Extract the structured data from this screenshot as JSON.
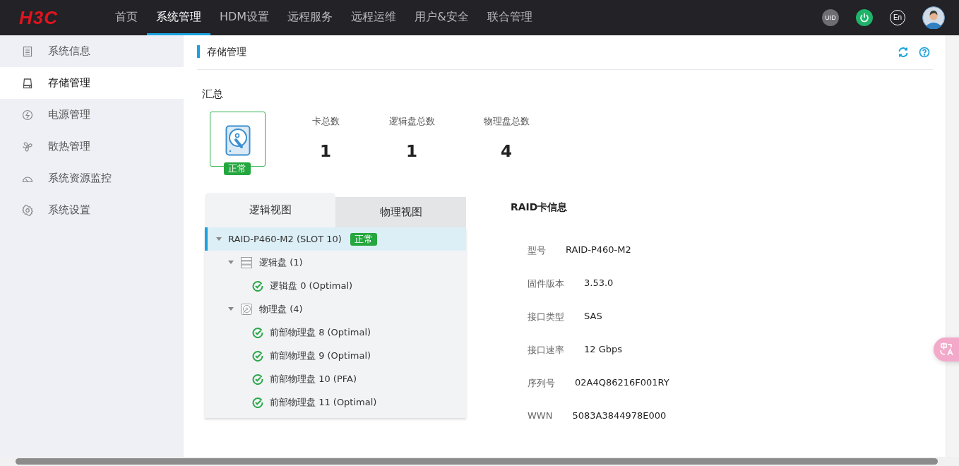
{
  "topbar": {
    "logo": "H3C",
    "nav": [
      {
        "label": "首页",
        "selected": false
      },
      {
        "label": "系统管理",
        "selected": true
      },
      {
        "label": "HDM设置",
        "selected": false
      },
      {
        "label": "远程服务",
        "selected": false
      },
      {
        "label": "远程运维",
        "selected": false
      },
      {
        "label": "用户&安全",
        "selected": false
      },
      {
        "label": "联合管理",
        "selected": false
      }
    ],
    "uid_label": "UID",
    "language_label": "En"
  },
  "sidebar": {
    "items": [
      {
        "label": "系统信息",
        "kind": "list",
        "selected": false
      },
      {
        "label": "存储管理",
        "kind": "drive",
        "selected": true
      },
      {
        "label": "电源管理",
        "kind": "power",
        "selected": false
      },
      {
        "label": "散热管理",
        "kind": "fan",
        "selected": false
      },
      {
        "label": "系统资源监控",
        "kind": "gauge",
        "selected": false
      },
      {
        "label": "系统设置",
        "kind": "gear",
        "selected": false
      }
    ]
  },
  "page": {
    "title": "存储管理"
  },
  "summary": {
    "title": "汇总",
    "status": "正常",
    "stats": [
      {
        "label": "卡总数",
        "value": "1"
      },
      {
        "label": "逻辑盘总数",
        "value": "1"
      },
      {
        "label": "物理盘总数",
        "value": "4"
      }
    ]
  },
  "tabs": [
    {
      "label": "逻辑视图",
      "selected": true
    },
    {
      "label": "物理视图",
      "selected": false
    }
  ],
  "tree": [
    {
      "label": "RAID-P460-M2 (SLOT 10)",
      "badge": "正常",
      "selected": true,
      "expanded": true,
      "children": [
        {
          "label": "逻辑盘 (1)",
          "kind": "logical-group",
          "selected": false,
          "expanded": true,
          "children": [
            {
              "label": "逻辑盘 0 (Optimal)",
              "kind": "disk",
              "selected": false
            }
          ]
        },
        {
          "label": "物理盘 (4)",
          "kind": "physical-group",
          "selected": false,
          "expanded": true,
          "children": [
            {
              "label": "前部物理盘 8 (Optimal)",
              "kind": "disk",
              "selected": false
            },
            {
              "label": "前部物理盘 9 (Optimal)",
              "kind": "disk",
              "selected": false
            },
            {
              "label": "前部物理盘 10 (PFA)",
              "kind": "disk",
              "selected": false
            },
            {
              "label": "前部物理盘 11 (Optimal)",
              "kind": "disk",
              "selected": false
            }
          ]
        }
      ]
    }
  ],
  "raid_info": {
    "title": "RAID卡信息",
    "fields": [
      {
        "label": "型号",
        "value": "RAID-P460-M2"
      },
      {
        "label": "固件版本",
        "value": "3.53.0"
      },
      {
        "label": "接口类型",
        "value": "SAS"
      },
      {
        "label": "接口速率",
        "value": "12 Gbps"
      },
      {
        "label": "序列号",
        "value": "02A4Q86216F001RY"
      },
      {
        "label": "WWN",
        "value": "5083A3844978E000"
      }
    ]
  }
}
